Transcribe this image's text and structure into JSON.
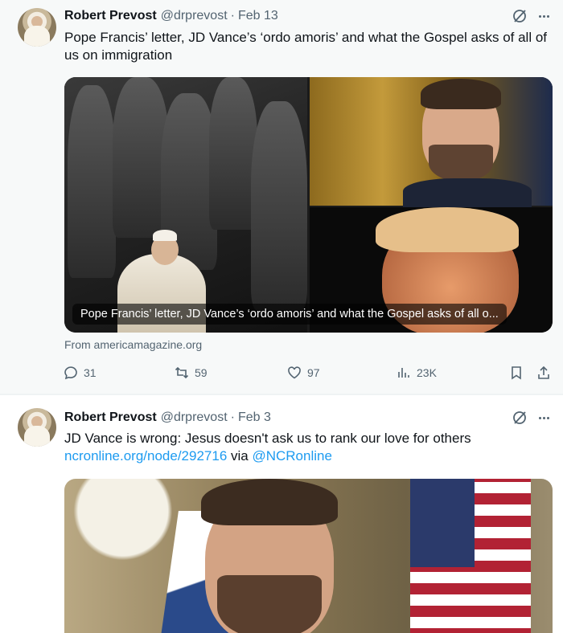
{
  "tweets": [
    {
      "author_name": "Robert Prevost",
      "handle": "@drprevost",
      "separator": "·",
      "date": "Feb 13",
      "text": "Pope Francis’ letter, JD Vance’s ‘ordo amoris’ and what the Gospel asks of all of us on immigration",
      "card_caption": "Pope Francis’ letter, JD Vance’s ‘ordo amoris’ and what the Gospel asks of all o...",
      "source": "From americamagazine.org",
      "replies": "31",
      "reposts": "59",
      "likes": "97",
      "views": "23K"
    },
    {
      "author_name": "Robert Prevost",
      "handle": "@drprevost",
      "separator": "·",
      "date": "Feb 3",
      "text_line1": "JD Vance is wrong: Jesus doesn't ask us to rank our love for others",
      "link_url": "ncronline.org/node/292716",
      "via_word": " via ",
      "mention": "@NCRonline"
    }
  ],
  "icons": {
    "grok": "grok-icon",
    "more": "more-icon",
    "reply": "reply-icon",
    "repost": "repost-icon",
    "like": "heart-icon",
    "views": "views-icon",
    "bookmark": "bookmark-icon",
    "share": "share-icon"
  },
  "colors": {
    "text": "#0f1419",
    "secondary": "#536471",
    "link": "#1d9bf0"
  }
}
